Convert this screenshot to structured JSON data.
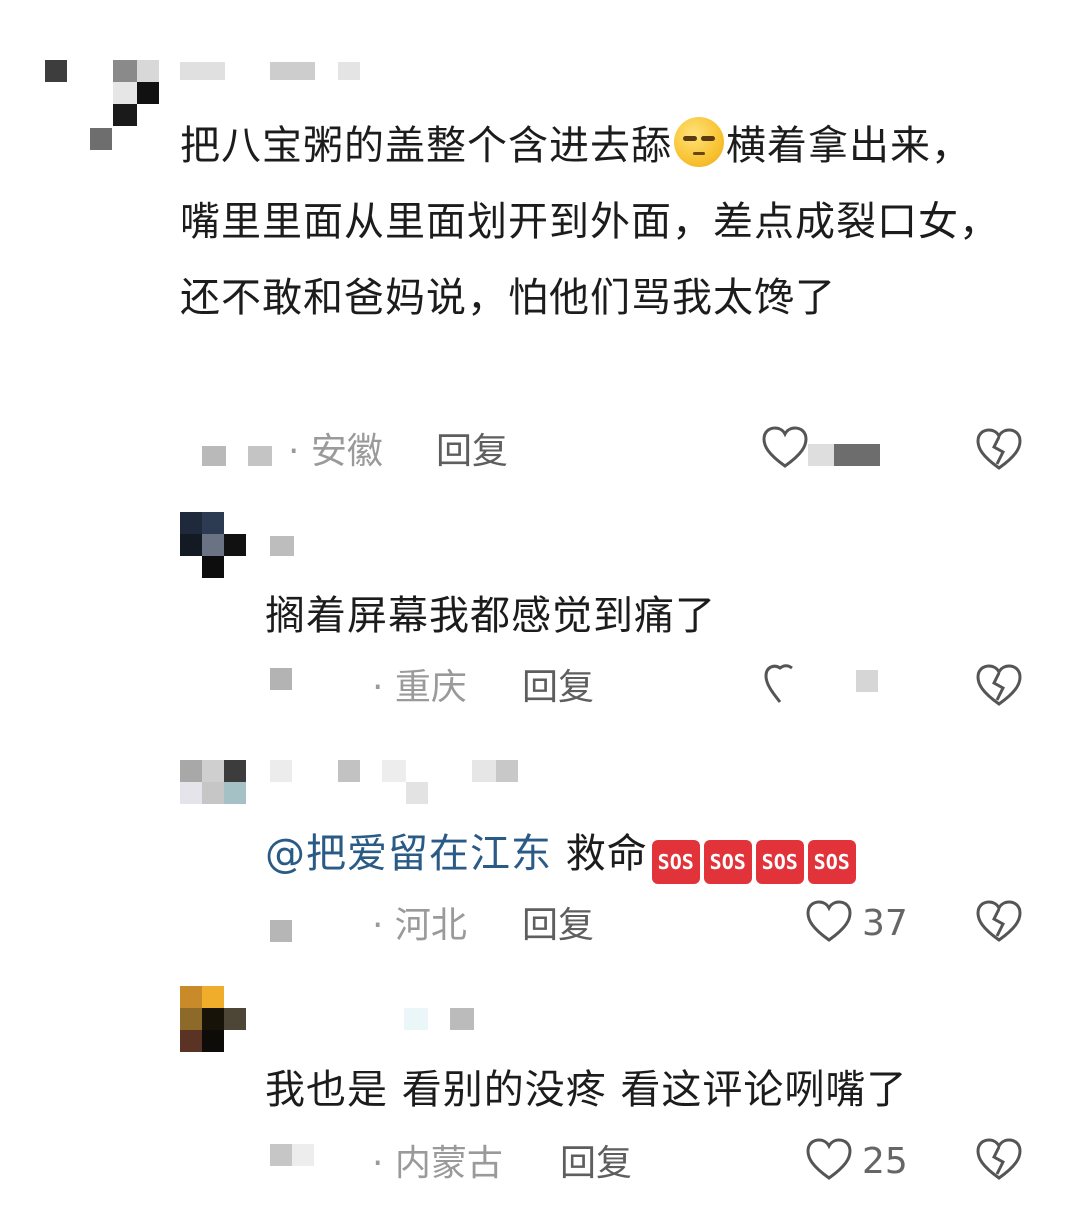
{
  "comments": [
    {
      "text_before_emoji": "把八宝粥的盖整个含进去舔",
      "emoji": "unamused-face-icon",
      "text_after_emoji": "横着拿出来，嘴里里面从里面划开到外面，差点成裂口女，还不敢和爸妈说，怕他们骂我太馋了",
      "location": "· 安徽",
      "reply_label": "回复",
      "like_icon": "heart-outline-icon",
      "dislike_icon": "broken-heart-icon"
    },
    {
      "text": "搁着屏幕我都感觉到痛了",
      "location": "· 重庆",
      "reply_label": "回复",
      "like_icon": "heart-outline-icon",
      "dislike_icon": "broken-heart-icon"
    },
    {
      "mention": "@把爱留在江东",
      "text": " 救命",
      "emoji": "sos-icon",
      "emoji_label": "SOS",
      "location": "· 河北",
      "reply_label": "回复",
      "likes": "37",
      "like_icon": "heart-outline-icon",
      "dislike_icon": "broken-heart-icon"
    },
    {
      "text": "我也是 看别的没疼 看这评论咧嘴了",
      "location": "· 内蒙古",
      "reply_label": "回复",
      "likes": "25",
      "like_icon": "heart-outline-icon",
      "dislike_icon": "broken-heart-icon"
    }
  ],
  "colors": {
    "mention": "#2a5b86",
    "meta": "#9a9a9a",
    "text": "#1c1c1c",
    "sos": "#e2323a"
  }
}
